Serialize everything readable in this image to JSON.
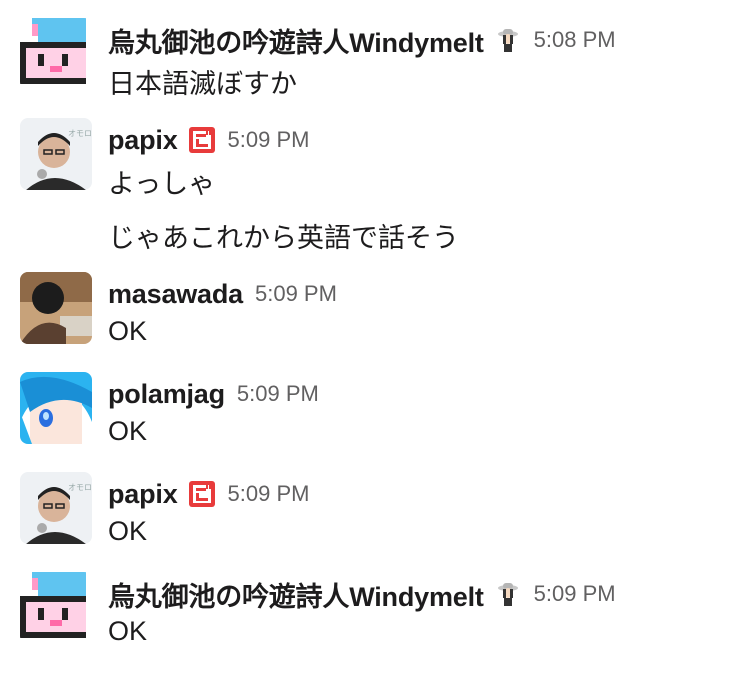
{
  "messages": [
    {
      "user": "烏丸御池の吟遊詩人Windymelt",
      "avatar": "pixel-cat-girl-avatar",
      "status": "girl-with-hat-emoji",
      "time": "5:08 PM",
      "lines": [
        "日本語滅ぼすか"
      ]
    },
    {
      "user": "papix",
      "avatar": "papix-photo-avatar",
      "status": "red-bi-emoji",
      "time": "5:09 PM",
      "lines": [
        "よっしゃ",
        "じゃあこれから英語で話そう"
      ]
    },
    {
      "user": "masawada",
      "avatar": "masawada-photo-avatar",
      "status": "",
      "time": "5:09 PM",
      "lines": [
        "OK"
      ]
    },
    {
      "user": "polamjag",
      "avatar": "blue-hair-anime-avatar",
      "status": "",
      "time": "5:09 PM",
      "lines": [
        "OK"
      ]
    },
    {
      "user": "papix",
      "avatar": "papix-photo-avatar",
      "status": "red-bi-emoji",
      "time": "5:09 PM",
      "lines": [
        "OK"
      ]
    },
    {
      "user": "烏丸御池の吟遊詩人Windymelt",
      "avatar": "pixel-cat-girl-avatar",
      "status": "girl-with-hat-emoji",
      "time": "5:09 PM",
      "lines": [
        "OK"
      ]
    }
  ]
}
